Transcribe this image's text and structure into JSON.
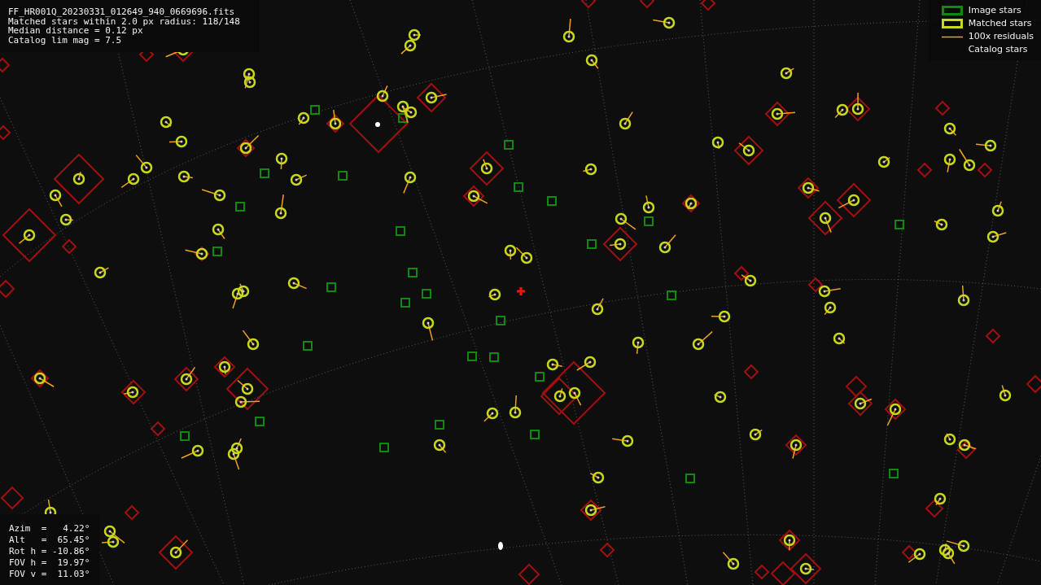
{
  "info_header": {
    "lines": [
      "FF_HR001Q_20230331_012649_940_0669696.fits",
      "Matched stars within 2.0 px radius: 118/148",
      "Median distance = 0.12 px",
      "Catalog lim mag = 7.5"
    ]
  },
  "legend": [
    {
      "kind": "image",
      "label": "Image stars"
    },
    {
      "kind": "matched",
      "label": "Matched stars"
    },
    {
      "kind": "residual",
      "label": "100x residuals"
    },
    {
      "kind": "catalog",
      "label": "Catalog stars"
    }
  ],
  "pointing": {
    "lines": [
      "Azim  =   4.22°",
      "Alt   =  65.45°",
      "Rot h = -10.86°",
      "FOV h =  19.97°",
      "FOV v =  11.03°"
    ]
  }
}
